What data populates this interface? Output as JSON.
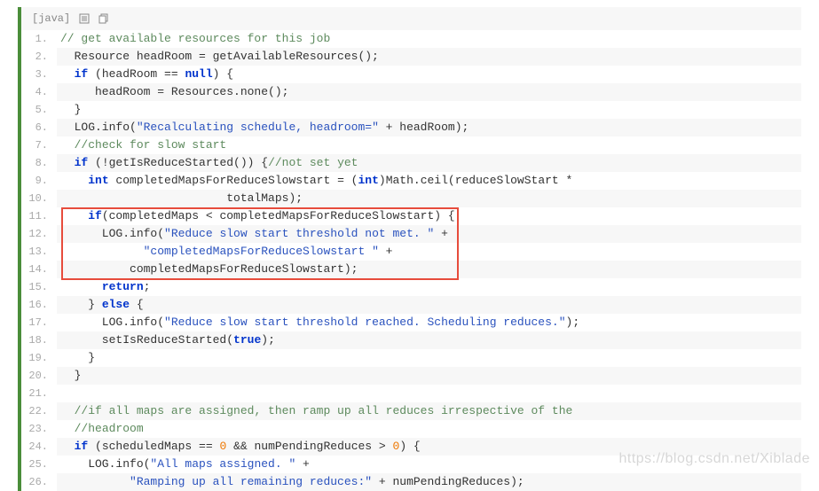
{
  "header": {
    "lang_label": "[java]"
  },
  "code": {
    "lines": [
      [
        [
          "c-comment",
          "// get available resources for this job"
        ]
      ],
      [
        [
          "",
          "  Resource headRoom = getAvailableResources();"
        ]
      ],
      [
        [
          "",
          "  "
        ],
        [
          "c-keyword",
          "if"
        ],
        [
          "",
          " (headRoom == "
        ],
        [
          "c-keyword",
          "null"
        ],
        [
          "",
          ") {"
        ]
      ],
      [
        [
          "",
          "     headRoom = Resources.none();"
        ]
      ],
      [
        [
          "",
          "  }"
        ]
      ],
      [
        [
          "",
          "  LOG.info("
        ],
        [
          "c-string",
          "\"Recalculating schedule, headroom=\""
        ],
        [
          "",
          " + headRoom);"
        ]
      ],
      [
        [
          "",
          "  "
        ],
        [
          "c-comment",
          "//check for slow start"
        ]
      ],
      [
        [
          "",
          "  "
        ],
        [
          "c-keyword",
          "if"
        ],
        [
          "",
          " (!getIsReduceStarted()) {"
        ],
        [
          "c-comment",
          "//not set yet"
        ]
      ],
      [
        [
          "",
          "    "
        ],
        [
          "c-type",
          "int"
        ],
        [
          "",
          " completedMapsForReduceSlowstart = ("
        ],
        [
          "c-type",
          "int"
        ],
        [
          "",
          ")Math.ceil(reduceSlowStart *"
        ]
      ],
      [
        [
          "",
          "                        totalMaps);"
        ]
      ],
      [
        [
          "",
          "    "
        ],
        [
          "c-keyword",
          "if"
        ],
        [
          "",
          "(completedMaps < completedMapsForReduceSlowstart) {"
        ]
      ],
      [
        [
          "",
          "      LOG.info("
        ],
        [
          "c-string",
          "\"Reduce slow start threshold not met. \""
        ],
        [
          "",
          " +"
        ]
      ],
      [
        [
          "",
          "            "
        ],
        [
          "c-string",
          "\"completedMapsForReduceSlowstart \""
        ],
        [
          "",
          " +"
        ]
      ],
      [
        [
          "",
          "          completedMapsForReduceSlowstart);"
        ]
      ],
      [
        [
          "",
          "      "
        ],
        [
          "c-keyword",
          "return"
        ],
        [
          "",
          ";"
        ]
      ],
      [
        [
          "",
          "    } "
        ],
        [
          "c-keyword",
          "else"
        ],
        [
          "",
          " {"
        ]
      ],
      [
        [
          "",
          "      LOG.info("
        ],
        [
          "c-string",
          "\"Reduce slow start threshold reached. Scheduling reduces.\""
        ],
        [
          "",
          ");"
        ]
      ],
      [
        [
          "",
          "      setIsReduceStarted("
        ],
        [
          "c-bool",
          "true"
        ],
        [
          "",
          ");"
        ]
      ],
      [
        [
          "",
          "    }"
        ]
      ],
      [
        [
          "",
          "  }"
        ]
      ],
      [
        [
          "",
          ""
        ]
      ],
      [
        [
          "",
          "  "
        ],
        [
          "c-comment",
          "//if all maps are assigned, then ramp up all reduces irrespective of the"
        ]
      ],
      [
        [
          "",
          "  "
        ],
        [
          "c-comment",
          "//headroom"
        ]
      ],
      [
        [
          "",
          "  "
        ],
        [
          "c-keyword",
          "if"
        ],
        [
          "",
          " (scheduledMaps == "
        ],
        [
          "c-num",
          "0"
        ],
        [
          "",
          " && numPendingReduces > "
        ],
        [
          "c-num",
          "0"
        ],
        [
          "",
          ") {"
        ]
      ],
      [
        [
          "",
          "    LOG.info("
        ],
        [
          "c-string",
          "\"All maps assigned. \""
        ],
        [
          "",
          " +"
        ]
      ],
      [
        [
          "",
          "          "
        ],
        [
          "c-string",
          "\"Ramping up all remaining reduces:\""
        ],
        [
          "",
          " + numPendingReduces);"
        ]
      ]
    ]
  },
  "watermark": "https://blog.csdn.net/Xiblade"
}
